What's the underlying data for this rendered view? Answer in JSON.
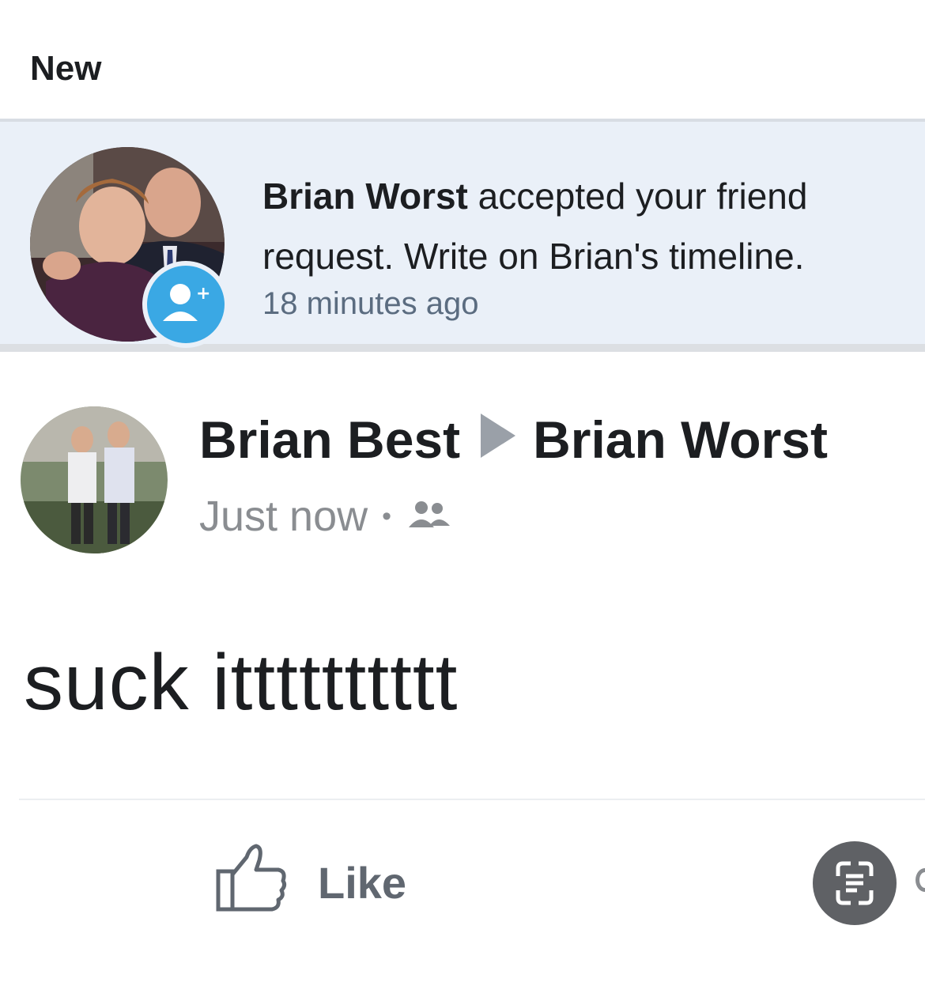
{
  "section": {
    "title": "New"
  },
  "notification": {
    "actor": "Brian Worst",
    "message": " accepted your friend request. Write on Brian's timeline.",
    "time": "18 minutes ago",
    "badge_icon": "add-friend-icon"
  },
  "post": {
    "author": "Brian Best",
    "target": "Brian Worst",
    "timestamp": "Just now",
    "separator": "•",
    "audience_icon": "friends-icon",
    "body": "suck itttttttttt",
    "like_label": "Like"
  },
  "colors": {
    "highlight_bg": "#eaf0f8",
    "badge_blue": "#3aa8e4",
    "text_dark": "#1c1e21",
    "text_muted": "#8a8d91"
  }
}
